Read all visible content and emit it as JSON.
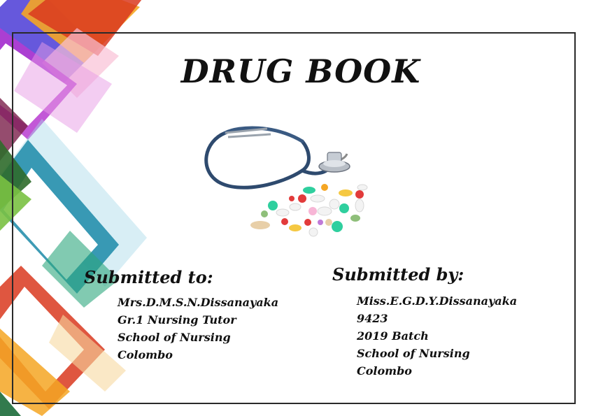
{
  "document": {
    "title": "DRUG BOOK",
    "submitted_to": {
      "heading": "Submitted to:",
      "lines": [
        "Mrs.D.M.S.N.Dissanayaka",
        "Gr.1 Nursing Tutor",
        "School of Nursing",
        "Colombo"
      ]
    },
    "submitted_by": {
      "heading": "Submitted by:",
      "lines": [
        "Miss.E.G.D.Y.Dissanayaka",
        "9423",
        "2019 Batch",
        "School of Nursing",
        "Colombo"
      ]
    }
  },
  "illustration": {
    "icon": "stethoscope-and-pills-icon"
  },
  "colors": {
    "text": "#111111",
    "frame": "#2a2a2a",
    "decor_red": "#d9381e",
    "decor_orange": "#f5a623",
    "decor_purple": "#b73bd0",
    "decor_teal": "#1c8aa8",
    "decor_green": "#7ac143",
    "decor_blue": "#4b3bd6"
  }
}
